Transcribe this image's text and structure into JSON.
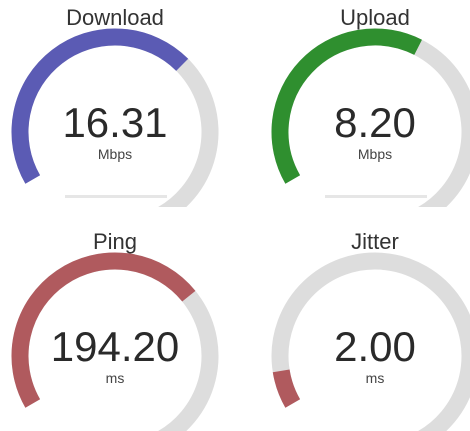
{
  "colors": {
    "track": "#dddddd",
    "download": "#5b5bb4",
    "upload": "#2f8f2f",
    "ping": "#b05a5e",
    "jitter": "#b05a5e"
  },
  "gauges": {
    "download": {
      "title": "Download",
      "value": "16.31",
      "unit": "Mbps",
      "fill_fraction": 0.55
    },
    "upload": {
      "title": "Upload",
      "value": "8.20",
      "unit": "Mbps",
      "fill_fraction": 0.49
    },
    "ping": {
      "title": "Ping",
      "value": "194.20",
      "unit": "ms",
      "fill_fraction": 0.57
    },
    "jitter": {
      "title": "Jitter",
      "value": "2.00",
      "unit": "ms",
      "fill_fraction": 0.07
    }
  }
}
